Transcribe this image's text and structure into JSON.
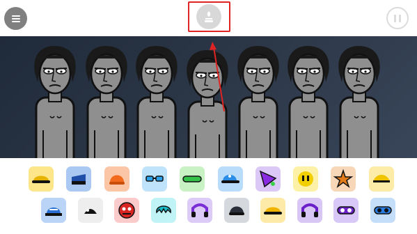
{
  "topbar": {
    "menu_icon": "menu-icon",
    "center_icon": "lamp-icon",
    "pause_icon": "pause-icon",
    "highlight_color": "#e02424"
  },
  "stage": {
    "background_colors": [
      "#1f2a3a",
      "#39465a"
    ],
    "character_count": 7
  },
  "sound_icons_row1": [
    {
      "name": "yellow-cap-icon",
      "bg": "#fde58a",
      "fg": "#e6b400"
    },
    {
      "name": "blue-visor-icon",
      "bg": "#a9c8f2",
      "fg": "#1f4fa8"
    },
    {
      "name": "orange-beanie-icon",
      "bg": "#fbc6a5",
      "fg": "#f26a1b"
    },
    {
      "name": "blue-glasses-icon",
      "bg": "#bfe3fb",
      "fg": "#2aa0e8"
    },
    {
      "name": "green-headband-icon",
      "bg": "#c9f2c4",
      "fg": "#34c24a"
    },
    {
      "name": "blue-cap-icon",
      "bg": "#b9dcfb",
      "fg": "#2b8de6"
    },
    {
      "name": "purple-triangle-icon",
      "bg": "#dcc8f7",
      "fg": "#8a2be2"
    },
    {
      "name": "yellow-smiley-icon",
      "bg": "#fdf1a8",
      "fg": "#f2cf00"
    },
    {
      "name": "orange-explosion-icon",
      "bg": "#f7d7b8",
      "fg": "#e07a1a"
    },
    {
      "name": "yellow-visor-icon",
      "bg": "#fdeba8",
      "fg": "#f0c400"
    }
  ],
  "sound_icons_row2": [
    {
      "name": "blue-hat-icon",
      "bg": "#b9d4f7",
      "fg": "#2a6fd6"
    },
    {
      "name": "white-mask-icon",
      "bg": "#eeeeee",
      "fg": "#111111"
    },
    {
      "name": "red-monster-icon",
      "bg": "#fbcaca",
      "fg": "#d92424"
    },
    {
      "name": "cyan-hair-icon",
      "bg": "#bff3f5",
      "fg": "#19b9c4"
    },
    {
      "name": "purple-headphones-icon",
      "bg": "#dccaf7",
      "fg": "#7a2ed6"
    },
    {
      "name": "dark-helmet-icon",
      "bg": "#d5d8dd",
      "fg": "#2a2f3a"
    },
    {
      "name": "yellow-cap-2-icon",
      "bg": "#fdeaa8",
      "fg": "#f0b400"
    },
    {
      "name": "purple-headphones-2-icon",
      "bg": "#d8c6f5",
      "fg": "#6a1fc9"
    },
    {
      "name": "purple-goggles-icon",
      "bg": "#d8c8f7",
      "fg": "#6b23c9"
    },
    {
      "name": "blue-goggles-icon",
      "bg": "#c4def9",
      "fg": "#2a7de0"
    }
  ]
}
